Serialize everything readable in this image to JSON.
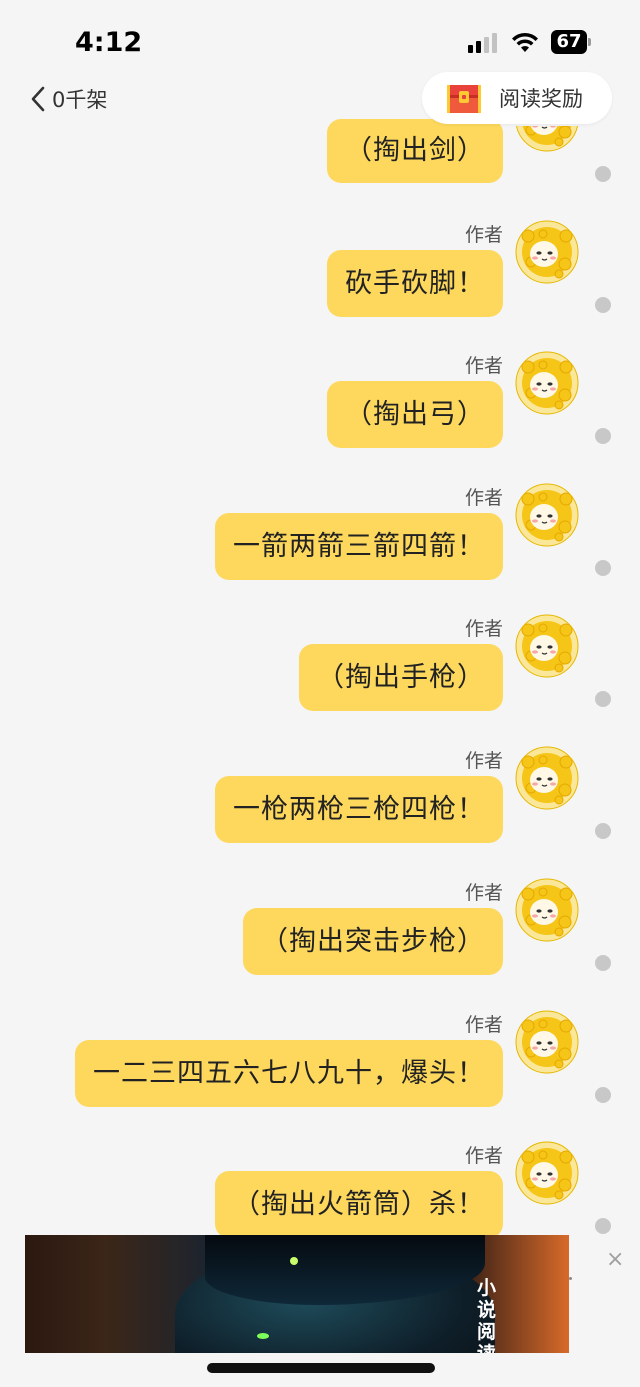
{
  "status_bar": {
    "time": "4:12",
    "battery": "67"
  },
  "header": {
    "back_label": "0千架",
    "reward_label": "阅读奖励"
  },
  "partial_message": {
    "text": "（掏出剑）"
  },
  "messages": [
    {
      "author": "作者",
      "text": "砍手砍脚！"
    },
    {
      "author": "作者",
      "text": "（掏出弓）"
    },
    {
      "author": "作者",
      "text": "一箭两箭三箭四箭！"
    },
    {
      "author": "作者",
      "text": "（掏出手枪）"
    },
    {
      "author": "作者",
      "text": "一枪两枪三枪四枪！"
    },
    {
      "author": "作者",
      "text": "（掏出突击步枪）"
    },
    {
      "author": "作者",
      "text": "一二三四五六七八九十，爆头！"
    },
    {
      "author": "作者",
      "text": "（掏出火箭筒）杀！"
    }
  ],
  "ad": {
    "text": "小说阅读",
    "close_icon": "×"
  },
  "icons": {
    "back": "chevron-left-icon",
    "reward": "treasure-chest-icon",
    "avatar": "author-avatar-icon",
    "close": "close-icon"
  },
  "colors": {
    "bubble": "#fdd85d",
    "background": "#f5f5f5"
  }
}
